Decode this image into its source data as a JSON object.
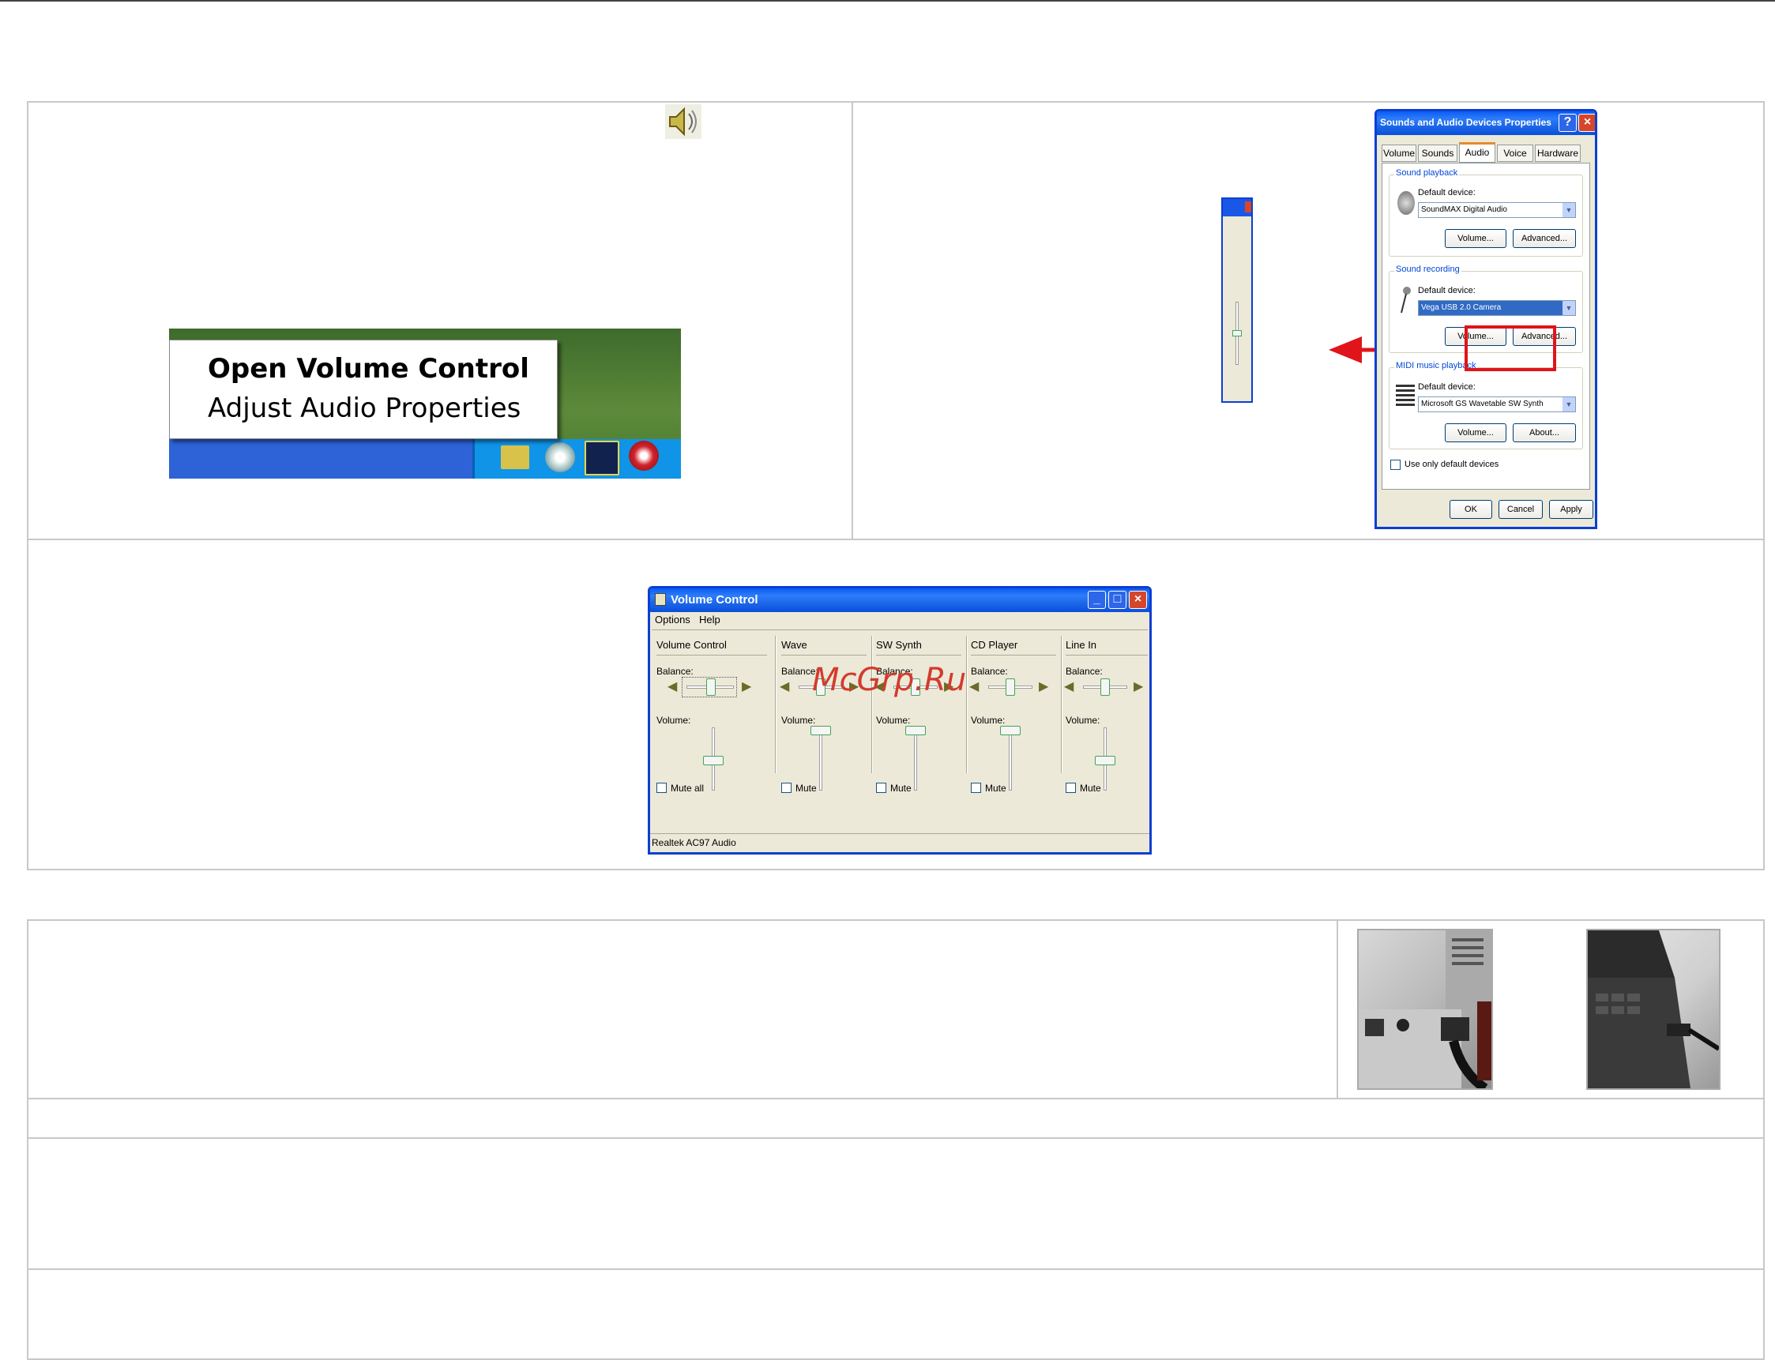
{
  "tray_menu": {
    "items": [
      "Open Volume Control",
      "Adjust Audio Properties"
    ]
  },
  "sound_props": {
    "title": "Sounds and Audio Devices Properties",
    "tabs": [
      "Volume",
      "Sounds",
      "Audio",
      "Voice",
      "Hardware"
    ],
    "active_tab": "Audio",
    "playback": {
      "group": "Sound playback",
      "label": "Default device:",
      "device": "SoundMAX Digital Audio",
      "buttons": [
        "Volume...",
        "Advanced..."
      ]
    },
    "recording": {
      "group": "Sound recording",
      "label": "Default device:",
      "device": "Vega USB 2.0 Camera",
      "buttons": [
        "Volume...",
        "Advanced..."
      ]
    },
    "midi": {
      "group": "MIDI music playback",
      "label": "Default device:",
      "device": "Microsoft GS Wavetable SW Synth",
      "buttons": [
        "Volume...",
        "About..."
      ]
    },
    "checkbox": "Use only default devices",
    "footer_buttons": [
      "OK",
      "Cancel",
      "Apply"
    ]
  },
  "volume_control": {
    "title": "Volume Control",
    "menu": [
      "Options",
      "Help"
    ],
    "columns": [
      {
        "name": "Volume Control",
        "mute": "Mute all"
      },
      {
        "name": "Wave",
        "mute": "Mute"
      },
      {
        "name": "SW Synth",
        "mute": "Mute"
      },
      {
        "name": "CD Player",
        "mute": "Mute"
      },
      {
        "name": "Line In",
        "mute": "Mute"
      }
    ],
    "balance_label": "Balance:",
    "volume_label": "Volume:",
    "status": "Realtek AC97 Audio"
  },
  "watermark": "McGrp.Ru"
}
